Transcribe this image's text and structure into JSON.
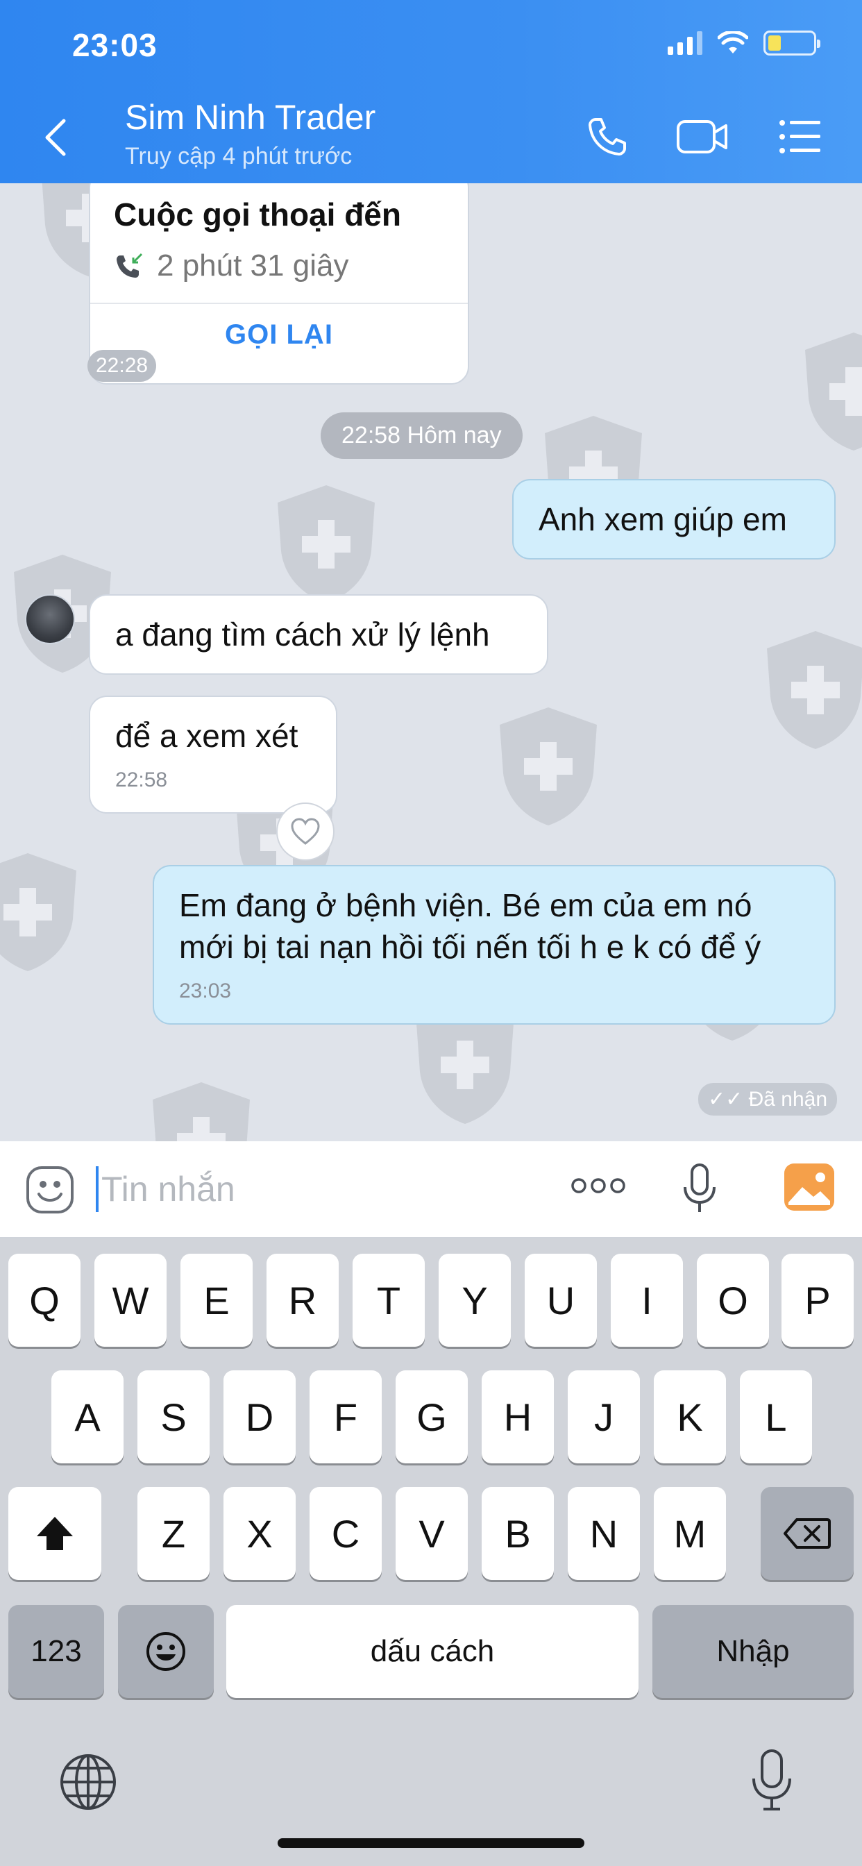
{
  "status_bar": {
    "time": "23:03"
  },
  "header": {
    "contact_name": "Sim Ninh Trader",
    "contact_status": "Truy cập 4 phút trước"
  },
  "chat": {
    "call_card": {
      "title": "Cuộc gọi thoại đến",
      "duration": "2 phút 31 giây",
      "action": "GỌI LẠI",
      "time": "22:28"
    },
    "date_separator": "22:58 Hôm nay",
    "messages": [
      {
        "direction": "out",
        "text": "Anh xem giúp em"
      },
      {
        "direction": "in",
        "text": "a đang tìm cách xử lý lệnh"
      },
      {
        "direction": "in",
        "text": "để a xem xét",
        "time": "22:58"
      },
      {
        "direction": "out",
        "text": "Em đang ở bệnh viện. Bé em của em nó mới bị tai nạn hồi tối nến tối h e k có để ý",
        "time": "23:03"
      }
    ],
    "receipt": "✓✓ Đã nhận"
  },
  "input": {
    "placeholder": "Tin nhắn"
  },
  "keyboard": {
    "row1": [
      "Q",
      "W",
      "E",
      "R",
      "T",
      "Y",
      "U",
      "I",
      "O",
      "P"
    ],
    "row2": [
      "A",
      "S",
      "D",
      "F",
      "G",
      "H",
      "J",
      "K",
      "L"
    ],
    "row3": [
      "Z",
      "X",
      "C",
      "V",
      "B",
      "N",
      "M"
    ],
    "numbers_key": "123",
    "space_key": "dấu cách",
    "return_key": "Nhập"
  },
  "colors": {
    "header": "#2f86f0",
    "outgoing_bubble": "#d2eefc",
    "incoming_bubble": "#ffffff",
    "gallery_icon": "#f5a04a"
  }
}
